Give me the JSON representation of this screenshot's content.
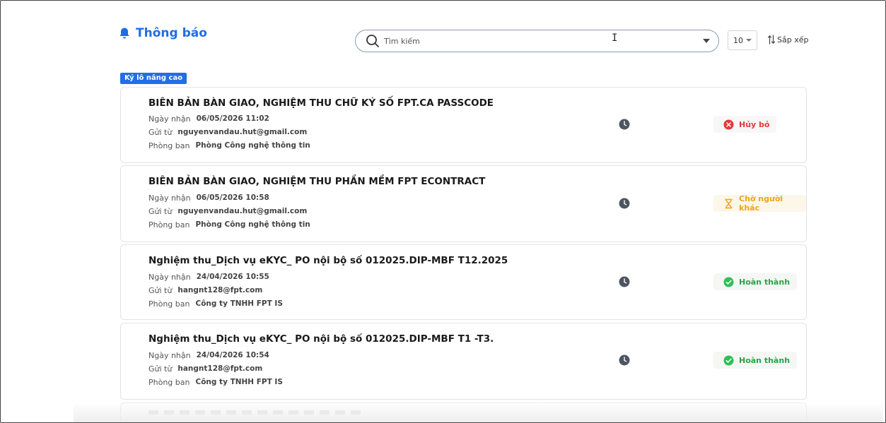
{
  "header": {
    "title": "Thông báo",
    "title_color": "#1f6fe5"
  },
  "search": {
    "placeholder": "Tìm kiếm",
    "value": ""
  },
  "toolbar": {
    "page_size": "10",
    "sort_label": "Sắp xếp"
  },
  "section": {
    "badge": "Ký lô nâng cao"
  },
  "labels": {
    "received": "Ngày nhận",
    "sender": "Gửi từ",
    "department": "Phòng ban"
  },
  "items": [
    {
      "title": "BIÊN BẢN BÀN GIAO, NGHIỆM THU CHỮ KÝ SỐ FPT.CA PASSCODE",
      "received": "06/05/2026 11:02",
      "sender": "nguyenvandau.hut@gmail.com",
      "department": "Phòng Công nghệ thông tin",
      "status": "Hủy bỏ",
      "status_icon": "cancel-circle-icon",
      "status_color": "#e23b3b"
    },
    {
      "title": "BIÊN BẢN BÀN GIAO, NGHIỆM THU PHẦN MỀM FPT ECONTRACT",
      "received": "06/05/2026 10:58",
      "sender": "nguyenvandau.hut@gmail.com",
      "department": "Phòng Công nghệ thông tin",
      "status": "Chờ người khác",
      "status_icon": "hourglass-icon",
      "status_color": "#f0a416"
    },
    {
      "title": "Nghiệm thu_Dịch vụ eKYC_ PO nội bộ số 012025.DIP-MBF T12.2025",
      "received": "24/04/2026 10:55",
      "sender": "hangnt128@fpt.com",
      "department": "Công ty TNHH FPT IS",
      "status": "Hoàn thành",
      "status_icon": "check-circle-icon",
      "status_color": "#2aa24a"
    },
    {
      "title": "Nghiệm thu_Dịch vụ eKYC_ PO nội bộ số 012025.DIP-MBF T1 -T3.",
      "received": "24/04/2026 10:54",
      "sender": "hangnt128@fpt.com",
      "department": "Công ty TNHH FPT IS",
      "status": "Hoàn thành",
      "status_icon": "check-circle-icon",
      "status_color": "#2aa24a"
    }
  ]
}
